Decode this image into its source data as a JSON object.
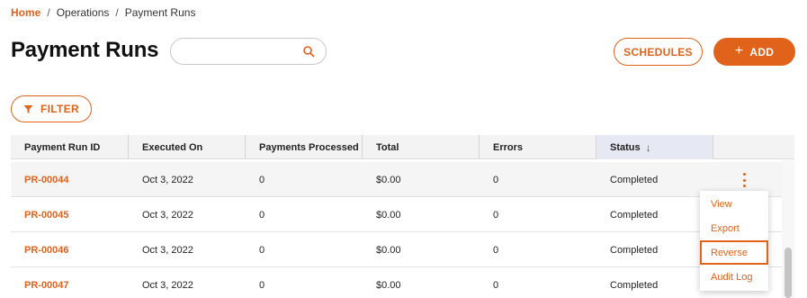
{
  "breadcrumb": {
    "home": "Home",
    "separator": "/",
    "items": [
      "Operations",
      "Payment Runs"
    ]
  },
  "page_title": "Payment Runs",
  "search": {
    "value": "",
    "placeholder": ""
  },
  "buttons": {
    "schedules": "SCHEDULES",
    "add": "ADD",
    "add_icon": "+",
    "filter": "FILTER"
  },
  "table": {
    "columns": [
      "Payment Run ID",
      "Executed On",
      "Payments Processed",
      "Total",
      "Errors",
      "Status"
    ],
    "sorted_column": "Status",
    "sort_direction": "descending",
    "sort_icon": "↓",
    "rows": [
      [
        "PR-00044",
        "Oct 3, 2022",
        "0",
        "$0.00",
        "0",
        "Completed"
      ],
      [
        "PR-00045",
        "Oct 3, 2022",
        "0",
        "$0.00",
        "0",
        "Completed"
      ],
      [
        "PR-00046",
        "Oct 3, 2022",
        "0",
        "$0.00",
        "0",
        "Completed"
      ],
      [
        "PR-00047",
        "Oct 3, 2022",
        "0",
        "$0.00",
        "0",
        "Completed"
      ]
    ]
  },
  "row_menu": {
    "items": [
      "View",
      "Export",
      "Reverse",
      "Audit Log"
    ],
    "focused_item": "Reverse"
  },
  "colors": {
    "accent": "#e0621b",
    "header_bg": "#f3f3f3",
    "sorted_header_bg": "#e6e8f3"
  }
}
